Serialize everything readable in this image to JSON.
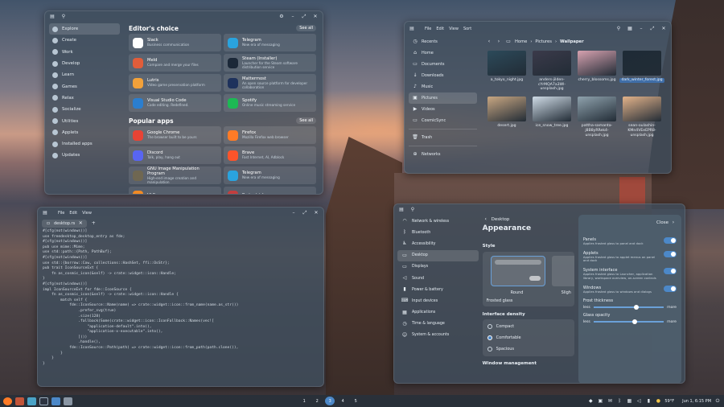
{
  "store": {
    "sidebar": [
      "Explore",
      "Create",
      "Work",
      "Develop",
      "Learn",
      "Games",
      "Relax",
      "Socialize",
      "Utilities",
      "Applets",
      "Installed apps",
      "Updates"
    ],
    "editors_title": "Editor's choice",
    "see_all": "See all",
    "editors": [
      {
        "t": "Slack",
        "d": "Business communication",
        "c": "#ffffff"
      },
      {
        "t": "Telegram",
        "d": "New era of messaging",
        "c": "#2aa3de"
      },
      {
        "t": "Meld",
        "d": "Compare and merge your files",
        "c": "#e05d3a"
      },
      {
        "t": "Steam (Installer)",
        "d": "Launcher for the Steam software distribution service",
        "c": "#1b2838"
      },
      {
        "t": "Lutris",
        "d": "Video game preservation platform",
        "c": "#f2a13a"
      },
      {
        "t": "Mattermost",
        "d": "An open source platform for developer collaboration",
        "c": "#1e325c"
      },
      {
        "t": "Visual Studio Code",
        "d": "Code editing. Redefined.",
        "c": "#2b7ecf"
      },
      {
        "t": "Spotify",
        "d": "Online music streaming service",
        "c": "#1db954"
      }
    ],
    "popular_title": "Popular apps",
    "popular": [
      {
        "t": "Google Chrome",
        "d": "The browser built to be yours",
        "c": "#e84335"
      },
      {
        "t": "Firefox",
        "d": "Mozilla Firefox web browser",
        "c": "#ff7b26"
      },
      {
        "t": "Discord",
        "d": "Talk, play, hang out",
        "c": "#5865f2"
      },
      {
        "t": "Brave",
        "d": "Fast Internet, AI, Adblock",
        "c": "#fb542b"
      },
      {
        "t": "GNU Image Manipulation Program",
        "d": "High-end image creation and manipulation",
        "c": "#6f6752"
      },
      {
        "t": "Telegram",
        "d": "New era of messaging",
        "c": "#2aa3de"
      },
      {
        "t": "VLC",
        "d": "",
        "c": "#f08a24"
      },
      {
        "t": "Protontricks",
        "d": "",
        "c": "#c23e3e"
      }
    ]
  },
  "files": {
    "menu": [
      "File",
      "Edit",
      "View",
      "Sort"
    ],
    "sidebar": [
      "Recents",
      "Home",
      "Documents",
      "Downloads",
      "Music",
      "Pictures",
      "Videos",
      "CosmicSync",
      "Trash",
      "Networks"
    ],
    "crumbs": [
      "Home",
      "Pictures",
      "Wallpaper"
    ],
    "items": [
      {
        "n": "a_tokyo_night.jpg",
        "c": "#2c4a5a"
      },
      {
        "n": "anders-jilden-cYrMQA7a3Wl-unsplash.jpg",
        "c": "#3b3a4a"
      },
      {
        "n": "cherry_blossoms.jpg",
        "c": "#d7a2b0"
      },
      {
        "n": "dark_winter_forest.jpg",
        "c": "#1e2b36"
      },
      {
        "n": "desert.jpg",
        "c": "#c9a782"
      },
      {
        "n": "ice_snow_tree.jpg",
        "c": "#cfdbe6"
      },
      {
        "n": "pattha-samanta-j8B8yRRek4-unsplash.jpg",
        "c": "#8fa2ad"
      },
      {
        "n": "sean-oulashin-KMn4VEeEPR8-unsplash.jpg",
        "c": "#e3b38a"
      }
    ]
  },
  "editor": {
    "menu": [
      "File",
      "Edit",
      "View"
    ],
    "tab": "desktop.rs",
    "lines": [
      "#[cfg(not(windows))]",
      "use freedesktop_desktop_entry as fde;",
      "#[cfg(not(windows))]",
      "pub use mime::Mime;",
      "use std::path::{Path, PathBuf};",
      "#[cfg(not(windows))]",
      "use std::{borrow::Cow, collections::HashSet, ffi::OsStr};",
      "",
      "pub trait IconSourceExt {",
      "    fn as_cosmic_icon(&self) -> crate::widget::icon::Handle;",
      "}",
      "",
      "#[cfg(not(windows))]",
      "impl IconSourceExt for fde::IconSource {",
      "    fn as_cosmic_icon(&self) -> crate::widget::icon::Handle {",
      "        match self {",
      "            fde::IconSource::Name(name) => crate::widget::icon::from_name(name.as_str())",
      "                .prefer_svg(true)",
      "                .size(128)",
      "                .fallback(Some(crate::widget::icon::IconFallback::Names(vec![",
      "                    \"application-default\".into(),",
      "                    \"application-x-executable\".into(),",
      "                ])))",
      "                .handle(),",
      "            fde::IconSource::Path(path) => crate::widget::icon::from_path(path.clone()),",
      "        }",
      "    }",
      "}"
    ]
  },
  "settings": {
    "sidebar": [
      "Network & wireless",
      "Bluetooth",
      "Accessibility",
      "Desktop",
      "Displays",
      "Sound",
      "Power & battery",
      "Input devices",
      "Applications",
      "Time & language",
      "System & accounts"
    ],
    "back": "Desktop",
    "title": "Appearance",
    "style": "Style",
    "round": "Round",
    "slight": "Sligh",
    "frosted": "Frosted glass",
    "density": "Interface density",
    "densities": [
      "Compact",
      "Comfortable",
      "Spacious"
    ],
    "wm": "Window management",
    "close": "Close",
    "panel": [
      {
        "t": "Panels",
        "d": "Applies frosted glass to panel and dock"
      },
      {
        "t": "Applets",
        "d": "Applies frosted glass to applet menus on panel and dock"
      },
      {
        "t": "System interface",
        "d": "Applies frosted glass to Launcher, application library, workspace overview, on-screen controls"
      },
      {
        "t": "Windows",
        "d": "Applies frosted glass to windows and dialogs"
      }
    ],
    "thick": "Frost thickness",
    "opacity": "Glass opacity",
    "less": "less",
    "more": "more"
  },
  "taskbar": {
    "workspaces": [
      "1",
      "2",
      "3",
      "4",
      "5"
    ],
    "weather": "59°F",
    "clock": "Jun 1, 6:15 PM"
  }
}
